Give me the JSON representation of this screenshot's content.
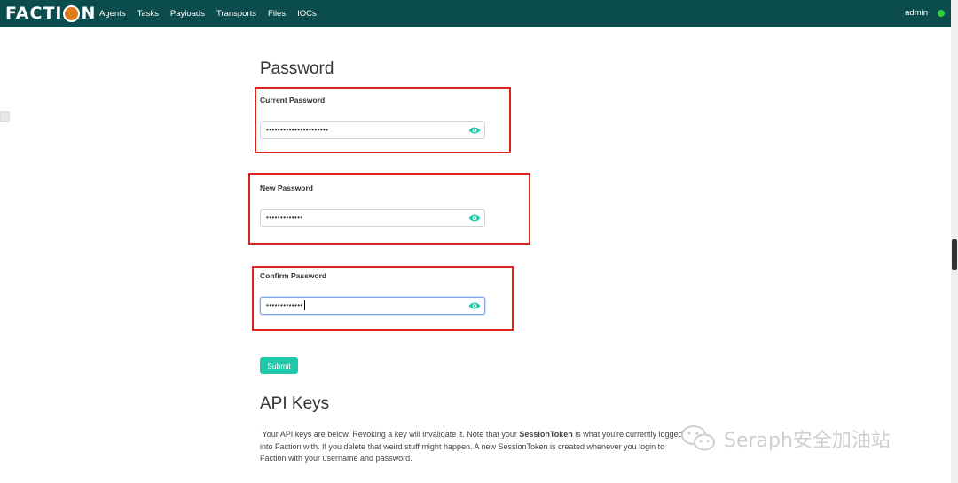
{
  "brand": {
    "text_before": "FACTI",
    "text_after": "N"
  },
  "nav": [
    "Agents",
    "Tasks",
    "Payloads",
    "Transports",
    "Files",
    "IOCs"
  ],
  "user": {
    "name": "admin"
  },
  "password_section": {
    "title": "Password",
    "current": {
      "label": "Current Password",
      "value": "••••••••••••••••••••••"
    },
    "new": {
      "label": "New Password",
      "value": "•••••••••••••"
    },
    "confirm": {
      "label": "Confirm Password",
      "value": "•••••••••••••"
    },
    "submit_label": "Submit"
  },
  "api_keys": {
    "title": "API Keys",
    "desc_1": "Your API keys are below. Revoking a key will invalidate it. Note that your ",
    "desc_bold": "SessionToken",
    "desc_2": " is what you're currently logged into Faction with. If you delete that weird stuff might happen. A new SessionToken is created whenever you login to Faction with your username and password."
  },
  "watermark": {
    "text": "Seraph安全加油站"
  },
  "colors": {
    "nav_bg": "#0b4d4d",
    "accent": "#1fc8a8",
    "highlight_box": "#d9251d",
    "status": "#2ecc40"
  },
  "icons": {
    "eye": "eye-icon",
    "status": "status-online"
  }
}
